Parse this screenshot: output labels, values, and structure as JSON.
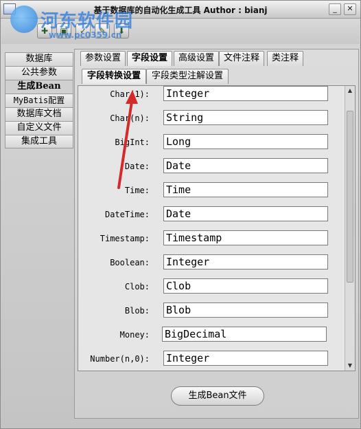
{
  "window": {
    "title": "基于数据库的自动化生成工具  Author : bianj",
    "min_label": "_",
    "close_label": "✕"
  },
  "watermark": {
    "site_name": "河东软件园",
    "url": "www.pc0359.cn"
  },
  "toolbar": {
    "icons": [
      "new-icon",
      "save-icon",
      "run-icon",
      "config-icon",
      "export-icon"
    ]
  },
  "sidebar": {
    "items": [
      {
        "label": "数据库"
      },
      {
        "label": "公共参数"
      },
      {
        "label": "生成Bean"
      },
      {
        "label": "MyBatis配置"
      },
      {
        "label": "数据库文档"
      },
      {
        "label": "自定义文件"
      },
      {
        "label": "集成工具"
      }
    ],
    "active_index": 2
  },
  "tabs": [
    {
      "label": "参数设置"
    },
    {
      "label": "字段设置"
    },
    {
      "label": "高级设置"
    },
    {
      "label": "文件注释"
    },
    {
      "label": "类注释"
    }
  ],
  "subtabs": [
    {
      "label": "字段转换设置"
    },
    {
      "label": "字段类型注解设置"
    }
  ],
  "mappings": [
    {
      "label": "Char(1):",
      "value": "Integer"
    },
    {
      "label": "Char(n):",
      "value": "String"
    },
    {
      "label": "BigInt:",
      "value": "Long"
    },
    {
      "label": "Date:",
      "value": "Date"
    },
    {
      "label": "Time:",
      "value": "Time"
    },
    {
      "label": "DateTime:",
      "value": "Date"
    },
    {
      "label": "Timestamp:",
      "value": "Timestamp"
    },
    {
      "label": "Boolean:",
      "value": "Integer"
    },
    {
      "label": "Clob:",
      "value": "Clob"
    },
    {
      "label": "Blob:",
      "value": "Blob"
    },
    {
      "label": "Money:",
      "value": "BigDecimal"
    },
    {
      "label": "Number(n,0):",
      "value": "Integer"
    }
  ],
  "actions": {
    "generate_label": "生成Bean文件"
  },
  "colors": {
    "annotation_arrow": "#d42a2a",
    "watermark_blue": "#2878dc"
  }
}
